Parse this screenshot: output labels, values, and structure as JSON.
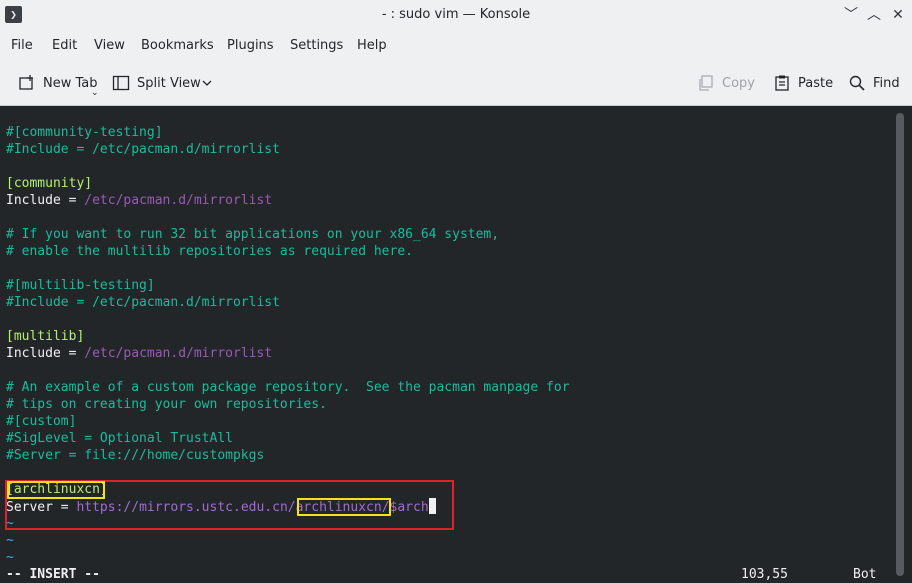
{
  "window": {
    "title": "- : sudo vim — Konsole",
    "app_icon_glyph": "❯",
    "controls": [
      "﹀",
      "︿",
      "✕"
    ]
  },
  "menubar": {
    "items": [
      "File",
      "Edit",
      "View",
      "Bookmarks",
      "Plugins",
      "Settings",
      "Help"
    ]
  },
  "toolbar": {
    "new_tab": "New Tab",
    "split_view": "Split View",
    "copy": "Copy",
    "paste": "Paste",
    "find": "Find"
  },
  "terminal": {
    "lines": [
      {
        "text": "#[community-testing]",
        "style": "comment"
      },
      {
        "text": "#Include = /etc/pacman.d/mirrorlist",
        "style": "comment"
      },
      {
        "text": "",
        "style": "plain"
      },
      {
        "text": "[community]",
        "style": "section"
      },
      {
        "key": "Include = ",
        "val": "/etc/pacman.d/mirrorlist",
        "style": "kv"
      },
      {
        "text": "",
        "style": "plain"
      },
      {
        "text": "# If you want to run 32 bit applications on your x86_64 system,",
        "style": "comment"
      },
      {
        "text": "# enable the multilib repositories as required here.",
        "style": "comment"
      },
      {
        "text": "",
        "style": "plain"
      },
      {
        "text": "#[multilib-testing]",
        "style": "comment"
      },
      {
        "text": "#Include = /etc/pacman.d/mirrorlist",
        "style": "comment"
      },
      {
        "text": "",
        "style": "plain"
      },
      {
        "text": "[multilib]",
        "style": "section"
      },
      {
        "key": "Include = ",
        "val": "/etc/pacman.d/mirrorlist",
        "style": "kv"
      },
      {
        "text": "",
        "style": "plain"
      },
      {
        "text": "# An example of a custom package repository.  See the pacman manpage for",
        "style": "comment"
      },
      {
        "text": "# tips on creating your own repositories.",
        "style": "comment"
      },
      {
        "text": "#[custom]",
        "style": "comment"
      },
      {
        "text": "#SigLevel = Optional TrustAll",
        "style": "comment"
      },
      {
        "text": "#Server = file:///home/custompkgs",
        "style": "comment"
      },
      {
        "text": "",
        "style": "plain"
      },
      {
        "text": "[archlinuxcn]",
        "style": "section"
      },
      {
        "key": "Server = ",
        "val": "https://mirrors.ustc.edu.cn/archlinuxcn/$arch",
        "style": "kv-url"
      },
      {
        "text": "~",
        "style": "tilde"
      },
      {
        "text": "~",
        "style": "tilde"
      },
      {
        "text": "~",
        "style": "tilde"
      }
    ],
    "mode": "-- INSERT --",
    "position": "103,55",
    "scroll": "Bot"
  },
  "colors": {
    "background": "#232629",
    "comment": "#1abc9c",
    "section": "#b4f06e",
    "path": "#9b59b6",
    "highlight_red": "#e0202b",
    "highlight_yellow": "#f5e313"
  }
}
